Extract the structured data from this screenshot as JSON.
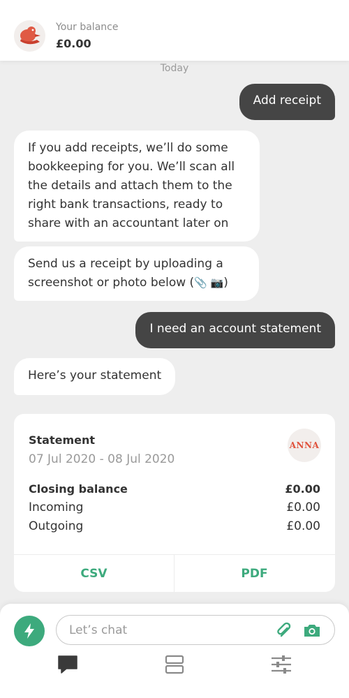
{
  "header": {
    "balance_label": "Your balance",
    "balance_value": "£0.00",
    "avatar_icon": "mascot-avatar-icon"
  },
  "chat": {
    "date_separator": "Today",
    "messages": [
      {
        "from": "user",
        "text": "Add receipt"
      },
      {
        "from": "bot",
        "text": "If you add receipts, we’ll do some bookkeeping for you. We’ll scan all the details and attach them to the right bank transactions, ready to share with an accountant later on"
      },
      {
        "from": "bot",
        "text": "Send us a receipt by uploading a screenshot or photo below (",
        "emoji": "📎 📷",
        "suffix": ")"
      },
      {
        "from": "user",
        "text": "I need an account statement"
      },
      {
        "from": "bot",
        "text": "Here’s your statement"
      }
    ]
  },
  "statement": {
    "title": "Statement",
    "date_range": "07 Jul 2020 - 08 Jul 2020",
    "logo_text": "ANNA",
    "rows": [
      {
        "label": "Closing balance",
        "value": "£0.00"
      },
      {
        "label": "Incoming",
        "value": "£0.00"
      },
      {
        "label": "Outgoing",
        "value": "£0.00"
      }
    ],
    "csv_label": "CSV",
    "pdf_label": "PDF"
  },
  "composer": {
    "placeholder": "Let’s chat",
    "left_icon": "bolt-icon",
    "attach_icon": "paperclip-icon",
    "camera_icon": "camera-icon"
  },
  "nav": {
    "items": [
      "chat-icon",
      "cards-icon",
      "settings-sliders-icon"
    ]
  },
  "colors": {
    "accent": "#3daa7d",
    "user_bubble": "#454545",
    "bot_bubble": "#ffffff",
    "background": "#eeeeee",
    "brand_red": "#e0533d"
  }
}
